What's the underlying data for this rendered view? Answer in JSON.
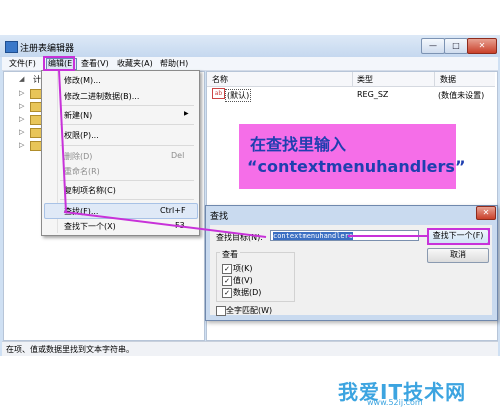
{
  "window": {
    "title": "注册表编辑器",
    "caption_buttons": {
      "minimize": "—",
      "maximize": "□",
      "close": "✕"
    }
  },
  "menubar": {
    "file": "文件(F)",
    "edit": "编辑(E)",
    "view": "查看(V)",
    "favorites": "收藏夹(A)",
    "help": "帮助(H)"
  },
  "list": {
    "headers": {
      "name": "名称",
      "type": "类型",
      "data": "数据"
    },
    "rows": [
      {
        "icon": "ab",
        "name": "(默认)",
        "type": "REG_SZ",
        "data": "(数值未设置)"
      }
    ]
  },
  "tree": {
    "root_prefix": "计"
  },
  "context_menu": {
    "items": [
      {
        "label": "修改(M)...",
        "disabled": false
      },
      {
        "label": "修改二进制数据(B)...",
        "disabled": false
      },
      {
        "label": "新建(N)",
        "disabled": false,
        "submenu": "▶"
      },
      {
        "label": "权限(P)...",
        "disabled": false
      },
      {
        "label": "删除(D)",
        "disabled": true,
        "shortcut": "Del"
      },
      {
        "label": "重命名(R)",
        "disabled": true
      },
      {
        "label": "复制项名称(C)",
        "disabled": false
      },
      {
        "label": "查找(F)...",
        "disabled": false,
        "shortcut": "Ctrl+F"
      },
      {
        "label": "查找下一个(X)",
        "disabled": false,
        "shortcut": "F3"
      }
    ]
  },
  "callout": {
    "line1": "在查找里输入",
    "line2": "“contextmenuhandlers”"
  },
  "find_dialog": {
    "title": "查找",
    "close": "✕",
    "label": "查找目标(N):",
    "value": "contextmenuhandlers",
    "find_next": "查找下一个(F)",
    "cancel": "取消",
    "look_at_title": "查看",
    "options": [
      {
        "label": "项(K)",
        "checked": true,
        "mark": "✓"
      },
      {
        "label": "值(V)",
        "checked": true,
        "mark": "✓"
      },
      {
        "label": "数据(D)",
        "checked": true,
        "mark": "✓"
      }
    ],
    "whole_string": {
      "label": "全字匹配(W)",
      "checked": false
    }
  },
  "statusbar": {
    "text": "在项、值或数据里找到文本字符串。"
  },
  "watermark": {
    "text": "我爱IT技术网",
    "url": "www.52ij.com"
  },
  "colors": {
    "callout_bg": "#f56ee8",
    "callout_text": "#1f3fb0",
    "annotation_line": "#c832d9"
  }
}
